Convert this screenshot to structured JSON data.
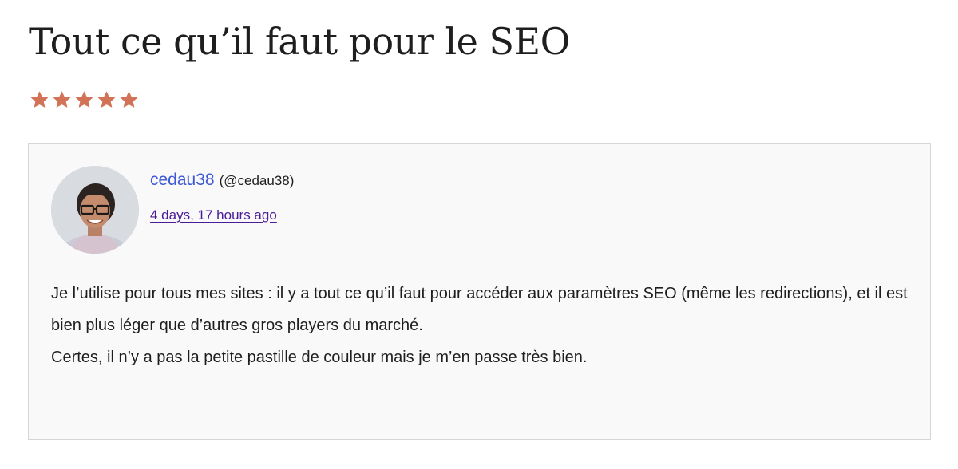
{
  "review": {
    "title": "Tout ce qu’il faut pour le SEO",
    "rating": 5,
    "rating_max": 5,
    "star_color": "#d27358",
    "author": {
      "name": "cedau38",
      "handle": "(@cedau38)",
      "name_color": "#3e58d6"
    },
    "date": "4 days, 17 hours ago",
    "date_color": "#4b1c96",
    "body": [
      "Je l’utilise pour tous mes sites : il y a tout ce qu’il faut pour accéder aux paramètres SEO (même les redirections), et il est bien plus léger que d’autres gros players du marché.",
      "Certes, il n’y a pas la petite pastille de couleur mais je m’en passe très bien."
    ]
  }
}
